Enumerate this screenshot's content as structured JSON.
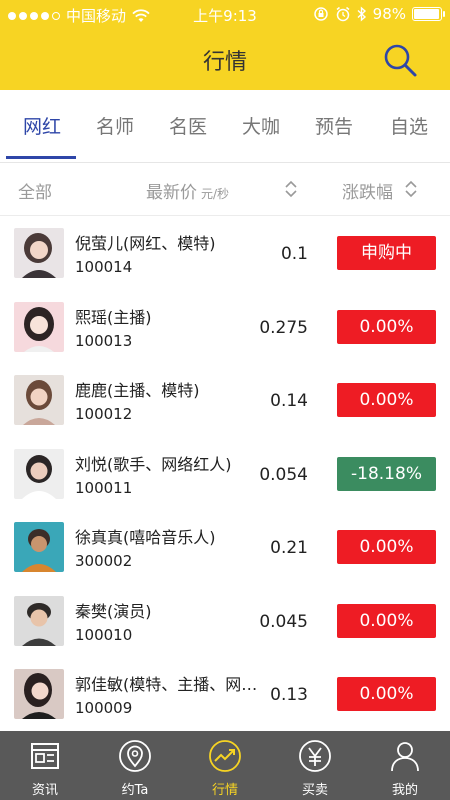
{
  "status_bar": {
    "carrier": "中国移动",
    "time": "上午9:13",
    "battery_percent": "98%",
    "battery_level": 0.98
  },
  "header": {
    "title": "行情",
    "search_icon": "search-icon"
  },
  "tabs": [
    {
      "label": "网红",
      "active": true
    },
    {
      "label": "名师",
      "active": false
    },
    {
      "label": "名医",
      "active": false
    },
    {
      "label": "大咖",
      "active": false
    },
    {
      "label": "预告",
      "active": false
    },
    {
      "label": "自选",
      "active": false
    }
  ],
  "columns": {
    "all": "全部",
    "price": "最新价",
    "price_unit": "元/秒",
    "change": "涨跌幅"
  },
  "rows": [
    {
      "name": "倪萤儿(网红、模特)",
      "code": "100014",
      "price": "0.1",
      "change": "申购中",
      "status": "red"
    },
    {
      "name": "熙瑶(主播)",
      "code": "100013",
      "price": "0.275",
      "change": "0.00%",
      "status": "red"
    },
    {
      "name": "鹿鹿(主播、模特)",
      "code": "100012",
      "price": "0.14",
      "change": "0.00%",
      "status": "red"
    },
    {
      "name": "刘悦(歌手、网络红人)",
      "code": "100011",
      "price": "0.054",
      "change": "-18.18%",
      "status": "green"
    },
    {
      "name": "徐真真(嘻哈音乐人)",
      "code": "300002",
      "price": "0.21",
      "change": "0.00%",
      "status": "red"
    },
    {
      "name": "秦樊(演员)",
      "code": "100010",
      "price": "0.045",
      "change": "0.00%",
      "status": "red"
    },
    {
      "name": "郭佳敏(模特、主播、网…",
      "code": "100009",
      "price": "0.13",
      "change": "0.00%",
      "status": "red"
    }
  ],
  "bottom_nav": [
    {
      "label": "资讯",
      "icon": "news-icon",
      "active": false
    },
    {
      "label": "约Ta",
      "icon": "location-pin-icon",
      "active": false
    },
    {
      "label": "行情",
      "icon": "trend-chart-icon",
      "active": true
    },
    {
      "label": "买卖",
      "icon": "yuan-icon",
      "active": false
    },
    {
      "label": "我的",
      "icon": "user-icon",
      "active": false
    }
  ],
  "colors": {
    "brand_yellow": "#f7d423",
    "tab_active": "#2e46a8",
    "badge_red": "#ee1c24",
    "badge_green": "#3b8c60",
    "nav_bg": "#595959"
  }
}
